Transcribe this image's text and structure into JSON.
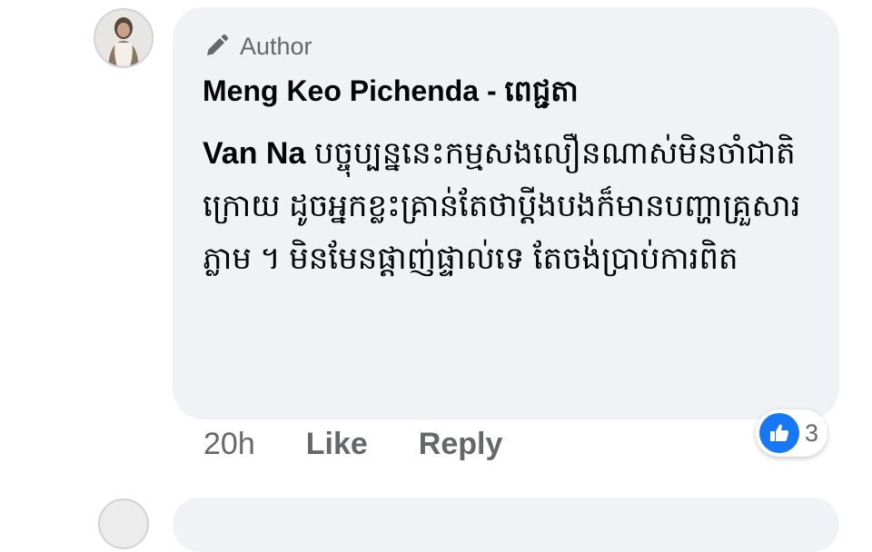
{
  "comment": {
    "badge": "Author",
    "author_name": "Meng Keo Pichenda - ពេជ្ជតា",
    "tagged_name": "Van Na",
    "text": "បច្ចុប្បន្ននេះកម្មសងលឿនណាស់មិនចាំជាតិក្រោយ ដូចអ្នកខ្លះគ្រាន់តែថាប្ដីងបងក៏មានបញ្ហាគ្រួសារភ្លាម ។ មិនមែនផ្ដាញ់ផ្ទាល់ទេ តែចង់ប្រាប់ការពិត"
  },
  "actions": {
    "time": "20h",
    "like": "Like",
    "reply": "Reply"
  },
  "reactions": {
    "count": "3",
    "icon": "like-thumb-icon",
    "color": "#1877f2"
  },
  "colors": {
    "bubble": "#f0f2f5",
    "secondary_text": "#65676b",
    "primary_text": "#050505"
  }
}
